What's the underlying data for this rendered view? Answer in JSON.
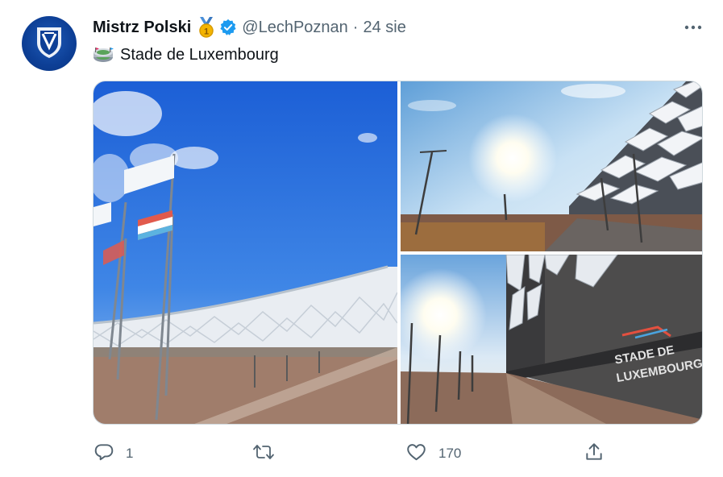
{
  "tweet": {
    "author_name": "Mistrz Polski",
    "handle": "@LechPoznan",
    "separator": "·",
    "date": "24 sie",
    "text": "Stade de Luxembourg"
  },
  "media": {
    "sign_line1": "STADE DE",
    "sign_line2": "LUXEMBOURG"
  },
  "actions": {
    "reply_count": "1",
    "retweet_count": "",
    "like_count": "170"
  },
  "icons": [
    "logo-icon",
    "medal-icon",
    "verified-icon",
    "more-icon",
    "stadium-icon",
    "reply-icon",
    "retweet-icon",
    "like-icon",
    "share-icon"
  ],
  "colors": {
    "verified": "#1d9bf0",
    "muted": "#536471",
    "brand_blue": "#0d3f96"
  }
}
